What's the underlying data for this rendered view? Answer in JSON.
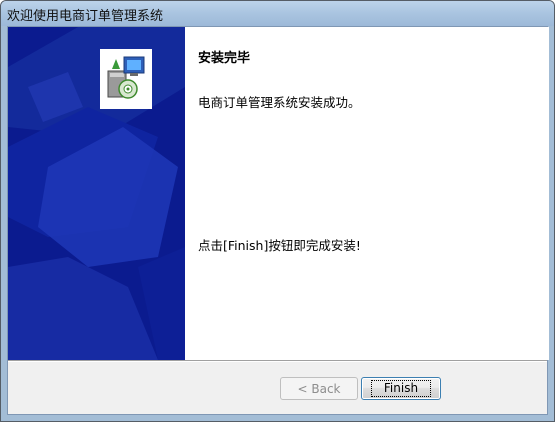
{
  "window": {
    "title": "欢迎使用电商订单管理系统"
  },
  "content": {
    "heading": "安装完毕",
    "message": "电商订单管理系统安装成功。",
    "hint": "点击[Finish]按钮即完成安装!"
  },
  "buttons": {
    "back_label": "< Back",
    "finish_label": "Finish"
  },
  "colors": {
    "hero_background": "#0b1b8f",
    "hero_shape": "#1f37b7"
  },
  "icons": {
    "installer": "installer-package-icon"
  }
}
